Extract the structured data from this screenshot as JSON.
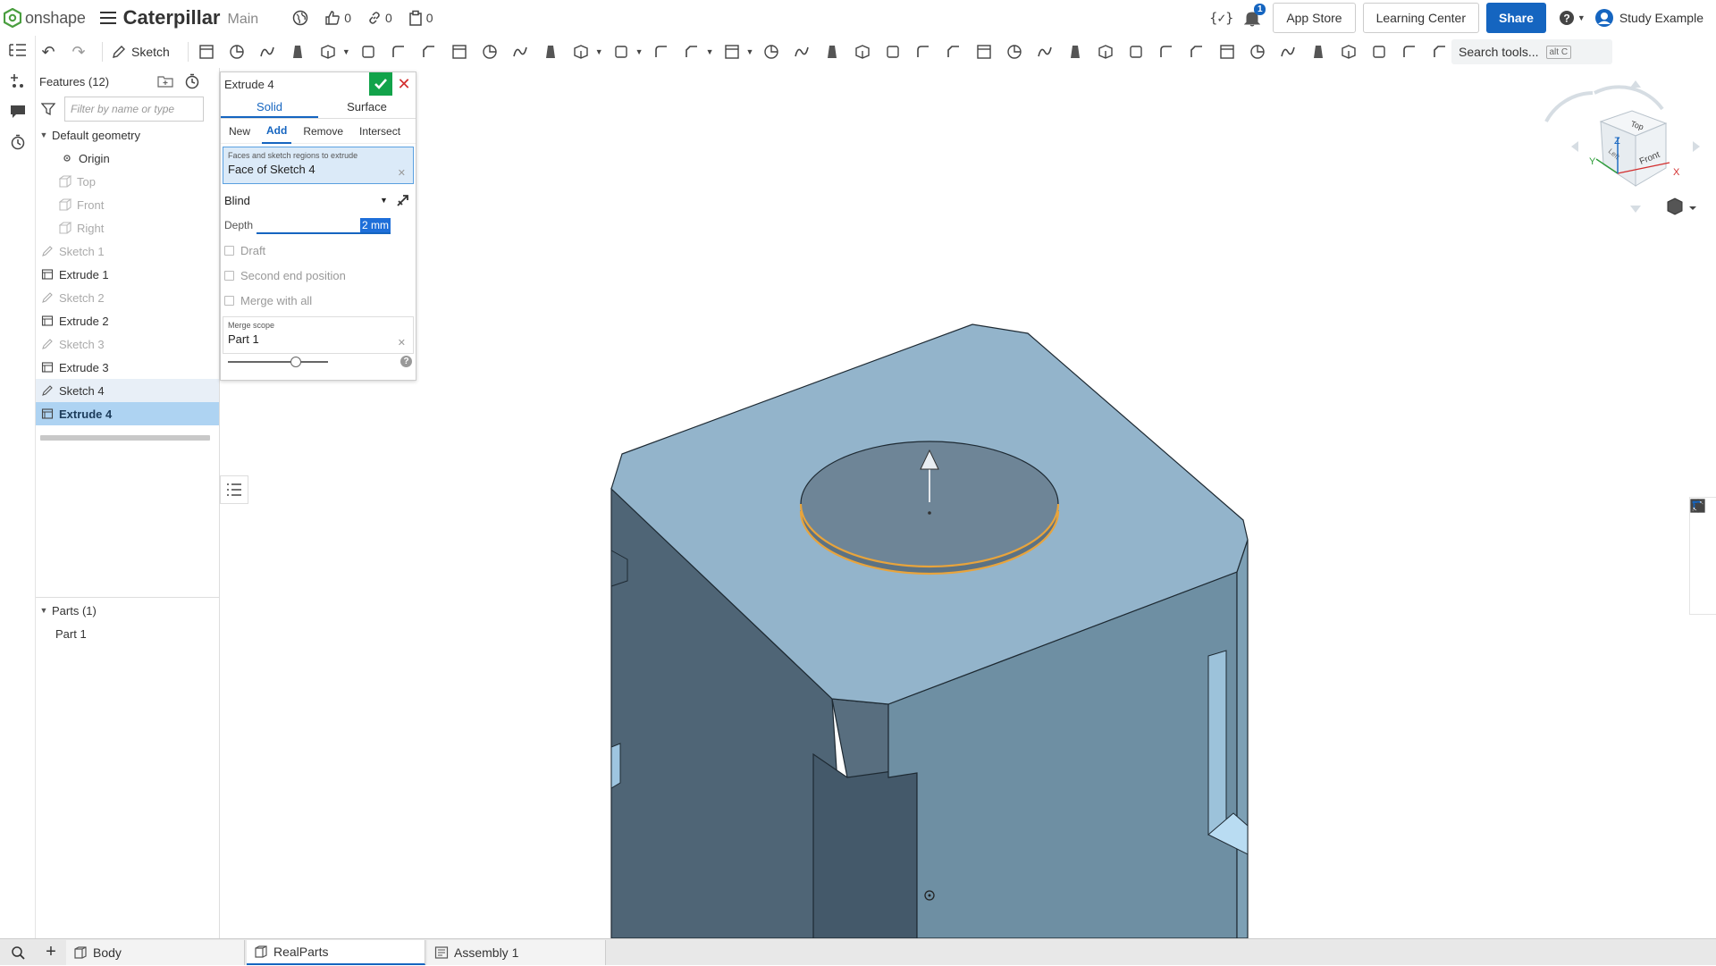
{
  "app": {
    "logo_text": "onshape",
    "document_title": "Caterpillar",
    "branch": "Main",
    "likes": "0",
    "links": "0",
    "copies": "0",
    "notification_count": "1",
    "app_store": "App Store",
    "learning_center": "Learning Center",
    "share": "Share",
    "user": "Study Example"
  },
  "toolbar": {
    "sketch_label": "Sketch",
    "search_label": "Search tools...",
    "search_shortcut": "alt C"
  },
  "features": {
    "header": "Features (12)",
    "filter_placeholder": "Filter by name or type",
    "default_geometry": "Default geometry",
    "origin": "Origin",
    "planes": [
      "Top",
      "Front",
      "Right"
    ],
    "items": [
      {
        "label": "Sketch 1",
        "kind": "sketch"
      },
      {
        "label": "Extrude 1",
        "kind": "extrude"
      },
      {
        "label": "Sketch 2",
        "kind": "sketch"
      },
      {
        "label": "Extrude 2",
        "kind": "extrude"
      },
      {
        "label": "Sketch 3",
        "kind": "sketch"
      },
      {
        "label": "Extrude 3",
        "kind": "extrude"
      },
      {
        "label": "Sketch 4",
        "kind": "sketch"
      },
      {
        "label": "Extrude 4",
        "kind": "extrude"
      }
    ],
    "parts_header": "Parts (1)",
    "parts": [
      "Part 1"
    ]
  },
  "dialog": {
    "title": "Extrude 4",
    "tabs": [
      "Solid",
      "Surface"
    ],
    "active_tab": "Solid",
    "operations": [
      "New",
      "Add",
      "Remove",
      "Intersect"
    ],
    "active_operation": "Add",
    "query_label": "Faces and sketch regions to extrude",
    "query_value": "Face of Sketch 4",
    "end_type": "Blind",
    "depth_label": "Depth",
    "depth_value": "2 mm",
    "draft": "Draft",
    "second_end": "Second end position",
    "merge_all": "Merge with all",
    "merge_scope_label": "Merge scope",
    "merge_scope_value": "Part 1"
  },
  "viewcube": {
    "top": "Top",
    "front": "Front",
    "left": "Left",
    "axis_x": "X",
    "axis_y": "Y",
    "axis_z": "Z"
  },
  "tabs": [
    {
      "label": "Body",
      "active": false
    },
    {
      "label": "RealParts",
      "active": true
    },
    {
      "label": "Assembly 1",
      "active": false
    }
  ],
  "colors": {
    "accent": "#1565c0",
    "confirm": "#12a34a",
    "cancel": "#d32f2f",
    "part_top": "#93b4cb",
    "part_left": "#4f6576",
    "part_right": "#6e8fa3",
    "highlight_edge": "#e8a43c"
  }
}
